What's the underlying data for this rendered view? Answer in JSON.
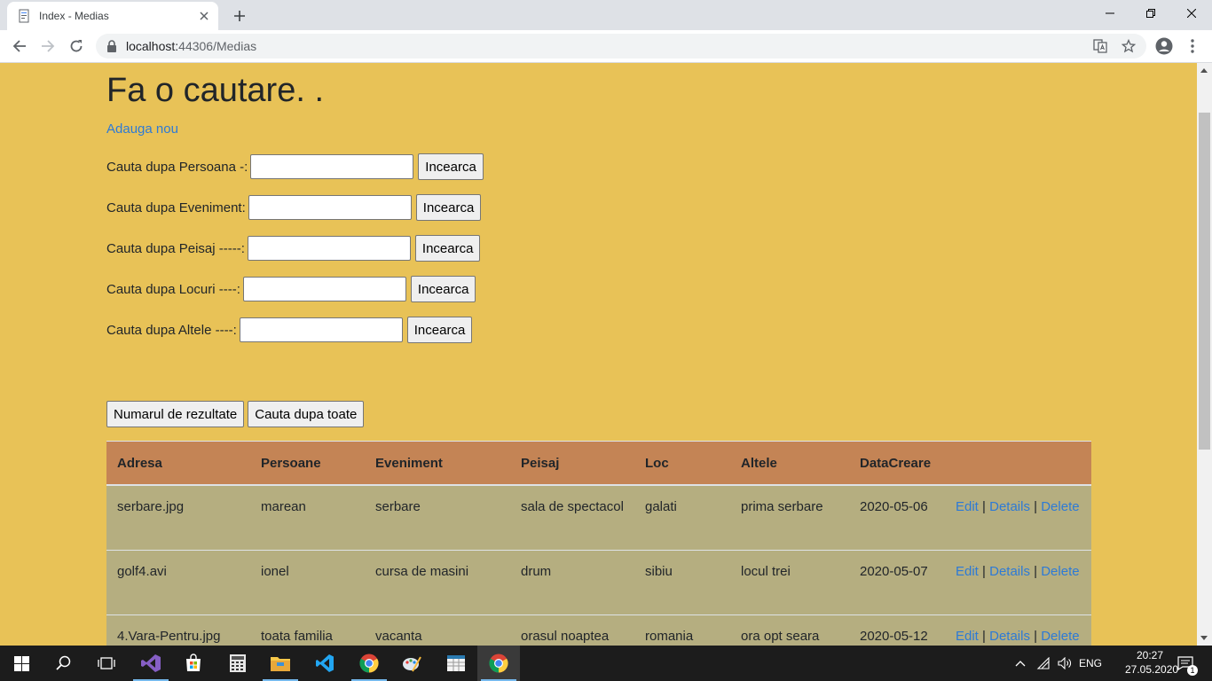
{
  "browser": {
    "tab_title": "Index - Medias",
    "url_host": "localhost:",
    "url_path": "44306/Medias"
  },
  "page": {
    "title": "Fa o cautare. .",
    "add_link": "Adauga nou",
    "searches": [
      {
        "label": "Cauta dupa Persoana -:",
        "value": "",
        "button": "Incearca"
      },
      {
        "label": "Cauta dupa Eveniment:",
        "value": "",
        "button": "Incearca"
      },
      {
        "label": "Cauta dupa Peisaj -----:",
        "value": "",
        "button": "Incearca"
      },
      {
        "label": "Cauta dupa Locuri ----:",
        "value": "",
        "button": "Incearca"
      },
      {
        "label": "Cauta dupa Altele ----:",
        "value": "",
        "button": "Incearca"
      }
    ],
    "count_button": "Numarul de rezultate",
    "search_all_button": "Cauta dupa toate"
  },
  "table": {
    "headers": [
      "Adresa",
      "Persoane",
      "Eveniment",
      "Peisaj",
      "Loc",
      "Altele",
      "DataCreare"
    ],
    "rows": [
      {
        "adresa": "serbare.jpg",
        "persoane": "marean",
        "eveniment": "serbare",
        "peisaj": "sala de spectacol",
        "loc": "galati",
        "altele": "prima serbare",
        "data": "2020-05-06"
      },
      {
        "adresa": "golf4.avi",
        "persoane": "ionel",
        "eveniment": "cursa de masini",
        "peisaj": "drum",
        "loc": "sibiu",
        "altele": "locul trei",
        "data": "2020-05-07"
      },
      {
        "adresa": "4.Vara-Pentru.jpg",
        "persoane": "toata familia",
        "eveniment": "vacanta",
        "peisaj": "orasul noaptea",
        "loc": "romania",
        "altele": "ora opt seara",
        "data": "2020-05-12"
      }
    ],
    "actions": {
      "edit": "Edit",
      "details": "Details",
      "delete": "Delete",
      "sep": "|"
    }
  },
  "taskbar": {
    "lang": "ENG",
    "time": "20:27",
    "date": "27.05.2020",
    "notif_count": "1"
  },
  "colors": {
    "page_bg": "#e8c257",
    "header_bg": "#c48455",
    "row_bg": "#b5ae80",
    "link": "#2d7ad6"
  }
}
